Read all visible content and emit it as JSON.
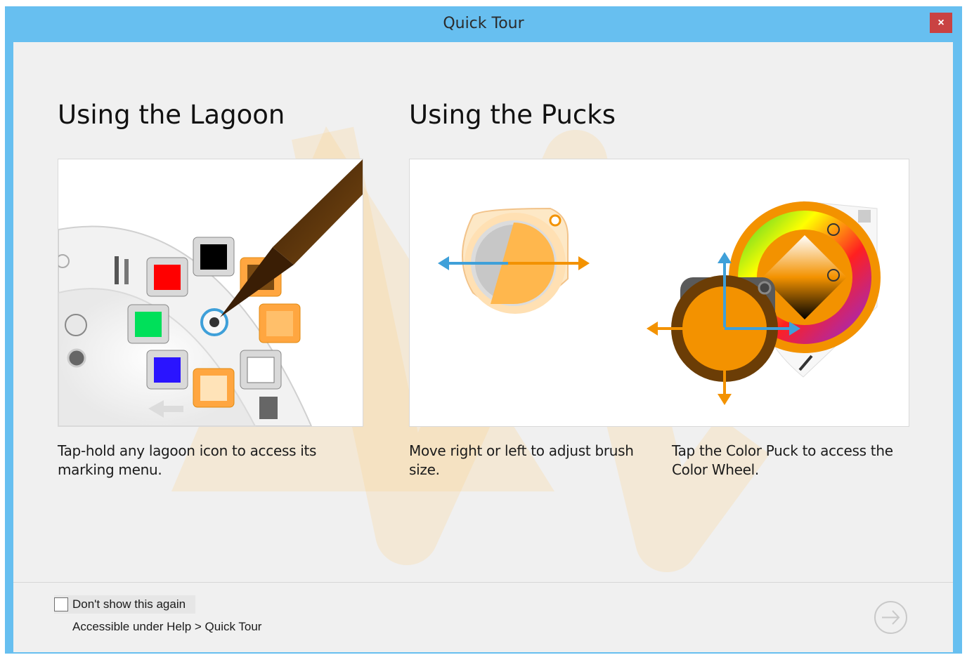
{
  "window": {
    "title": "Quick Tour",
    "close_label": "×"
  },
  "lagoon": {
    "heading": "Using the Lagoon",
    "caption": "Tap-hold any lagoon icon to access its marking menu."
  },
  "pucks": {
    "heading": "Using the Pucks",
    "caption_left": "Move right or left to adjust brush size.",
    "caption_right": "Tap the Color Puck to access the Color Wheel."
  },
  "footer": {
    "checkbox_label": "Don't show this again",
    "checkbox_checked": false,
    "help_text": "Accessible under Help > Quick Tour",
    "next_icon": "arrow-right-circle-icon"
  },
  "colors": {
    "titlebar": "#67bff0",
    "close": "#c94242",
    "accent_orange": "#f39200",
    "accent_blue": "#3fa0d9",
    "swatch_red": "#ff0000",
    "swatch_black": "#000000",
    "swatch_green": "#00e05a",
    "swatch_blue": "#2a14ff",
    "swatch_white": "#ffffff"
  }
}
